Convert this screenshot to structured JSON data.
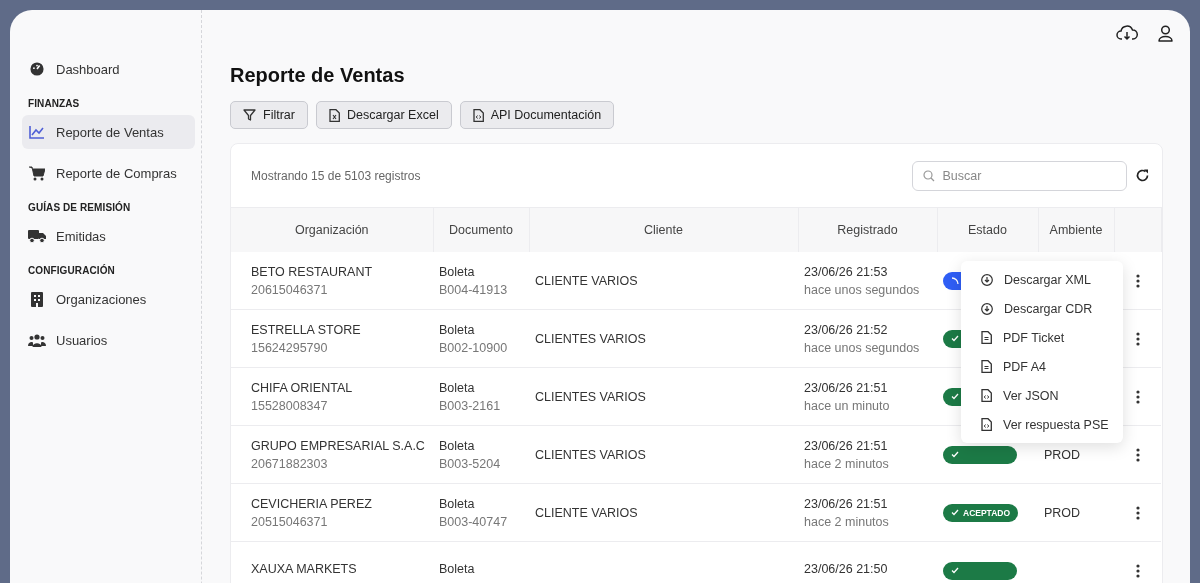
{
  "sidebar": {
    "items": [
      {
        "kind": "link",
        "label": "Dashboard",
        "selected": false
      },
      {
        "kind": "section",
        "label": "FINANZAS"
      },
      {
        "kind": "link",
        "label": "Reporte de Ventas",
        "selected": true
      },
      {
        "kind": "link",
        "label": "Reporte de Compras",
        "selected": false
      },
      {
        "kind": "section",
        "label": "GUÍAS DE REMISIÓN"
      },
      {
        "kind": "link",
        "label": "Emitidas",
        "selected": false
      },
      {
        "kind": "section",
        "label": "CONFIGURACIÓN"
      },
      {
        "kind": "link",
        "label": "Organizaciones",
        "selected": false
      },
      {
        "kind": "link",
        "label": "Usuarios",
        "selected": false
      }
    ]
  },
  "page": {
    "title": "Reporte de Ventas",
    "buttons": [
      {
        "kind": "filter",
        "label": "Filtrar"
      },
      {
        "kind": "excel",
        "label": "Descargar Excel"
      },
      {
        "kind": "doc",
        "label": "API Documentación"
      }
    ]
  },
  "table": {
    "summary": "Mostrando 15 de 5103 registros",
    "search": {
      "placeholder": "Buscar"
    },
    "columns": [
      "Organización",
      "Documento",
      "Cliente",
      "Registrado",
      "Estado",
      "Ambiente"
    ],
    "rows": [
      {
        "organization": "BETO RESTAURANT",
        "ruc": "20615046371",
        "doc_type": "Boleta",
        "doc_number": "B004-41913",
        "client": "CLIENTE VARIOS",
        "date": "23/06/26 21:53",
        "ago": "hace unos segundos",
        "status": {
          "kind": "pending"
        }
      },
      {
        "organization": "ESTRELLA STORE",
        "ruc": "15624295790",
        "doc_type": "Boleta",
        "doc_number": "B002-10900",
        "client": "CLIENTES VARIOS",
        "date": "23/06/26 21:52",
        "ago": "hace unos segundos",
        "status": {
          "kind": "accepted"
        }
      },
      {
        "organization": "CHIFA ORIENTAL",
        "ruc": "15528008347",
        "doc_type": "Boleta",
        "doc_number": "B003-2161",
        "client": "CLIENTES VARIOS",
        "date": "23/06/26 21:51",
        "ago": "hace un minuto",
        "status": {
          "kind": "accepted"
        }
      },
      {
        "organization": "GRUPO EMPRESARIAL S.A.C",
        "ruc": "20671882303",
        "doc_type": "Boleta",
        "doc_number": "B003-5204",
        "client": "CLIENTES VARIOS",
        "date": "23/06/26 21:51",
        "ago": "hace 2 minutos",
        "status": {
          "kind": "accepted"
        },
        "environment": "PROD"
      },
      {
        "organization": "CEVICHERIA PEREZ",
        "ruc": "20515046371",
        "doc_type": "Boleta",
        "doc_number": "B003-40747",
        "client": "CLIENTE VARIOS",
        "date": "23/06/26 21:51",
        "ago": "hace 2 minutos",
        "status": {
          "kind": "accepted",
          "label": "ACEPTADO"
        },
        "environment": "PROD"
      },
      {
        "organization": "XAUXA MARKETS",
        "doc_type": "Boleta",
        "date": "23/06/26 21:50",
        "status": {
          "kind": "accepted"
        }
      }
    ]
  },
  "row_menu": {
    "items": [
      {
        "kind": "download",
        "label": "Descargar XML"
      },
      {
        "kind": "download",
        "label": "Descargar CDR"
      },
      {
        "kind": "document",
        "label": "PDF Ticket"
      },
      {
        "kind": "document",
        "label": "PDF A4"
      },
      {
        "kind": "code",
        "label": "Ver JSON"
      },
      {
        "kind": "code",
        "label": "Ver respuesta PSE"
      }
    ]
  }
}
